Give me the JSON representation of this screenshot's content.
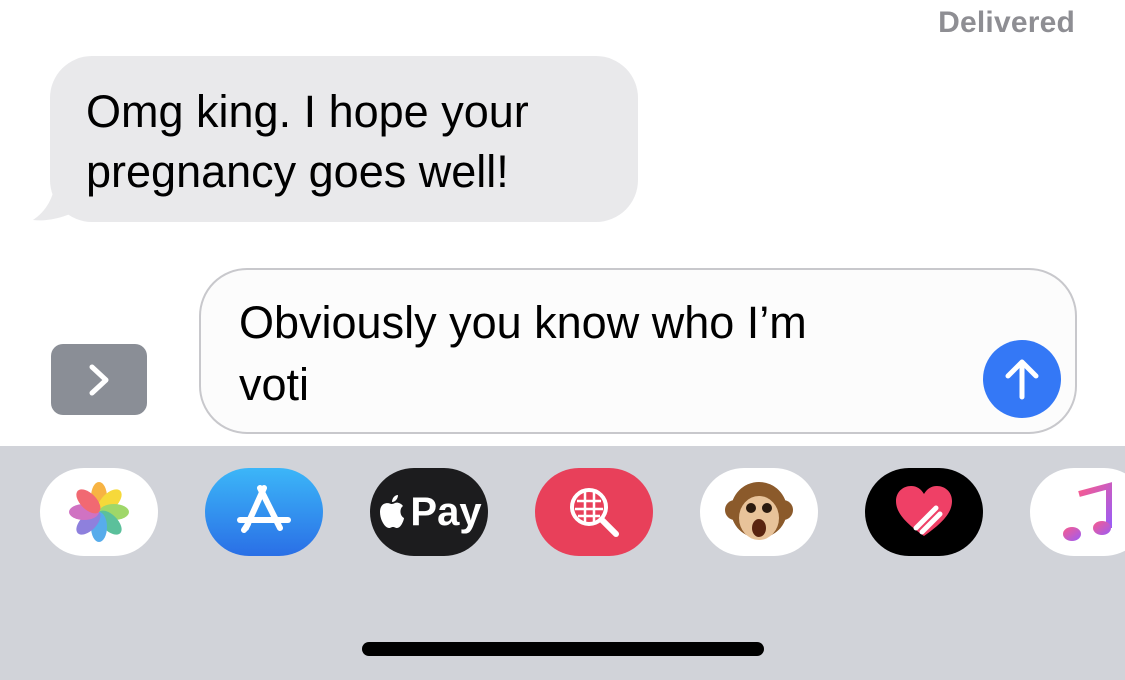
{
  "status": {
    "delivered": "Delivered"
  },
  "incoming_message": {
    "line1": "Omg king. I hope your",
    "line2": "pregnancy goes well!"
  },
  "composer": {
    "line1": "Obviously you know who I’m",
    "line2": "voti"
  },
  "app_tray": {
    "apps": [
      {
        "icon": "photos-icon"
      },
      {
        "icon": "app-store-icon"
      },
      {
        "icon": "apple-pay-icon",
        "label": "Pay"
      },
      {
        "icon": "image-search-icon"
      },
      {
        "icon": "memoji-monkey-icon"
      },
      {
        "icon": "digital-touch-icon"
      },
      {
        "icon": "music-icon"
      }
    ]
  },
  "colors": {
    "incoming_bubble": "#e9e9eb",
    "send_button": "#3478f6",
    "tray_background": "#d1d3d9"
  }
}
